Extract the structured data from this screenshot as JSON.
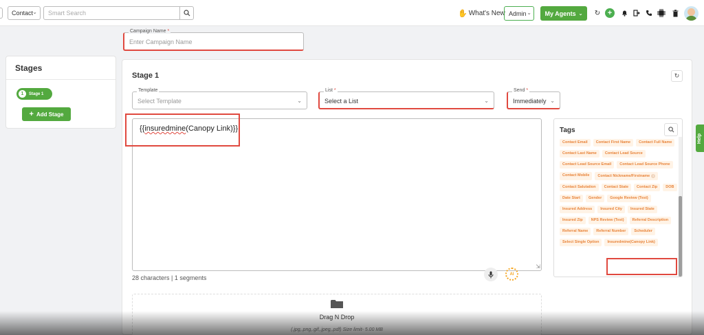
{
  "header": {
    "entity_select": "Contact",
    "search_placeholder": "Smart Search",
    "whats_new": "What's New",
    "role_select": "Admin",
    "agents_button": "My Agents"
  },
  "campaign": {
    "name_label": "Campaign Name",
    "name_required": "*",
    "name_placeholder": "Enter Campaign Name"
  },
  "stages": {
    "title": "Stages",
    "items": [
      {
        "number": "1",
        "label": "Stage 1"
      }
    ],
    "add_button": "Add Stage"
  },
  "stage": {
    "title": "Stage 1",
    "template": {
      "label": "Template",
      "placeholder": "Select Template"
    },
    "list": {
      "label": "List",
      "required": "*",
      "value": "Select a List"
    },
    "send": {
      "label": "Send",
      "required": "*",
      "value": "Immediately"
    },
    "message": {
      "prefix": "{{",
      "tag_word": "insuredmine",
      "suffix": "(Canopy Link)}}"
    },
    "char_count": "28 characters | 1 segments",
    "ai_label": "AI",
    "dropzone": {
      "title": "Drag N Drop",
      "formats": "(.jpg,.png,.gif,.jpeg,.pdf) Size limit- 5.00 MB"
    }
  },
  "tags": {
    "title": "Tags",
    "items": [
      "Contact Email",
      "Contact First Name",
      "Contact Full Name",
      "Contact Last Name",
      "Contact Lead Source",
      "Contact Lead Source Email",
      "Contact Lead Source Phone",
      "Contact Mobile",
      "Contact Nickname/Firstname",
      "Contact Salutation",
      "Contact State",
      "Contact Zip",
      "DOB",
      "Date Start",
      "Gender",
      "Google Review (Test)",
      "Insured Address",
      "Insured City",
      "Insured State",
      "Insured Zip",
      "NPS Review (Test)",
      "Referral Description",
      "Referral Name",
      "Referral Number",
      "Scheduler",
      "Select Single Option",
      "Insuredmine(Canopy Link)"
    ]
  },
  "help_tab": "Help",
  "colors": {
    "brand_green": "#53a93f",
    "highlight_red": "#e0483e",
    "tag_orange": "#e8843a"
  }
}
